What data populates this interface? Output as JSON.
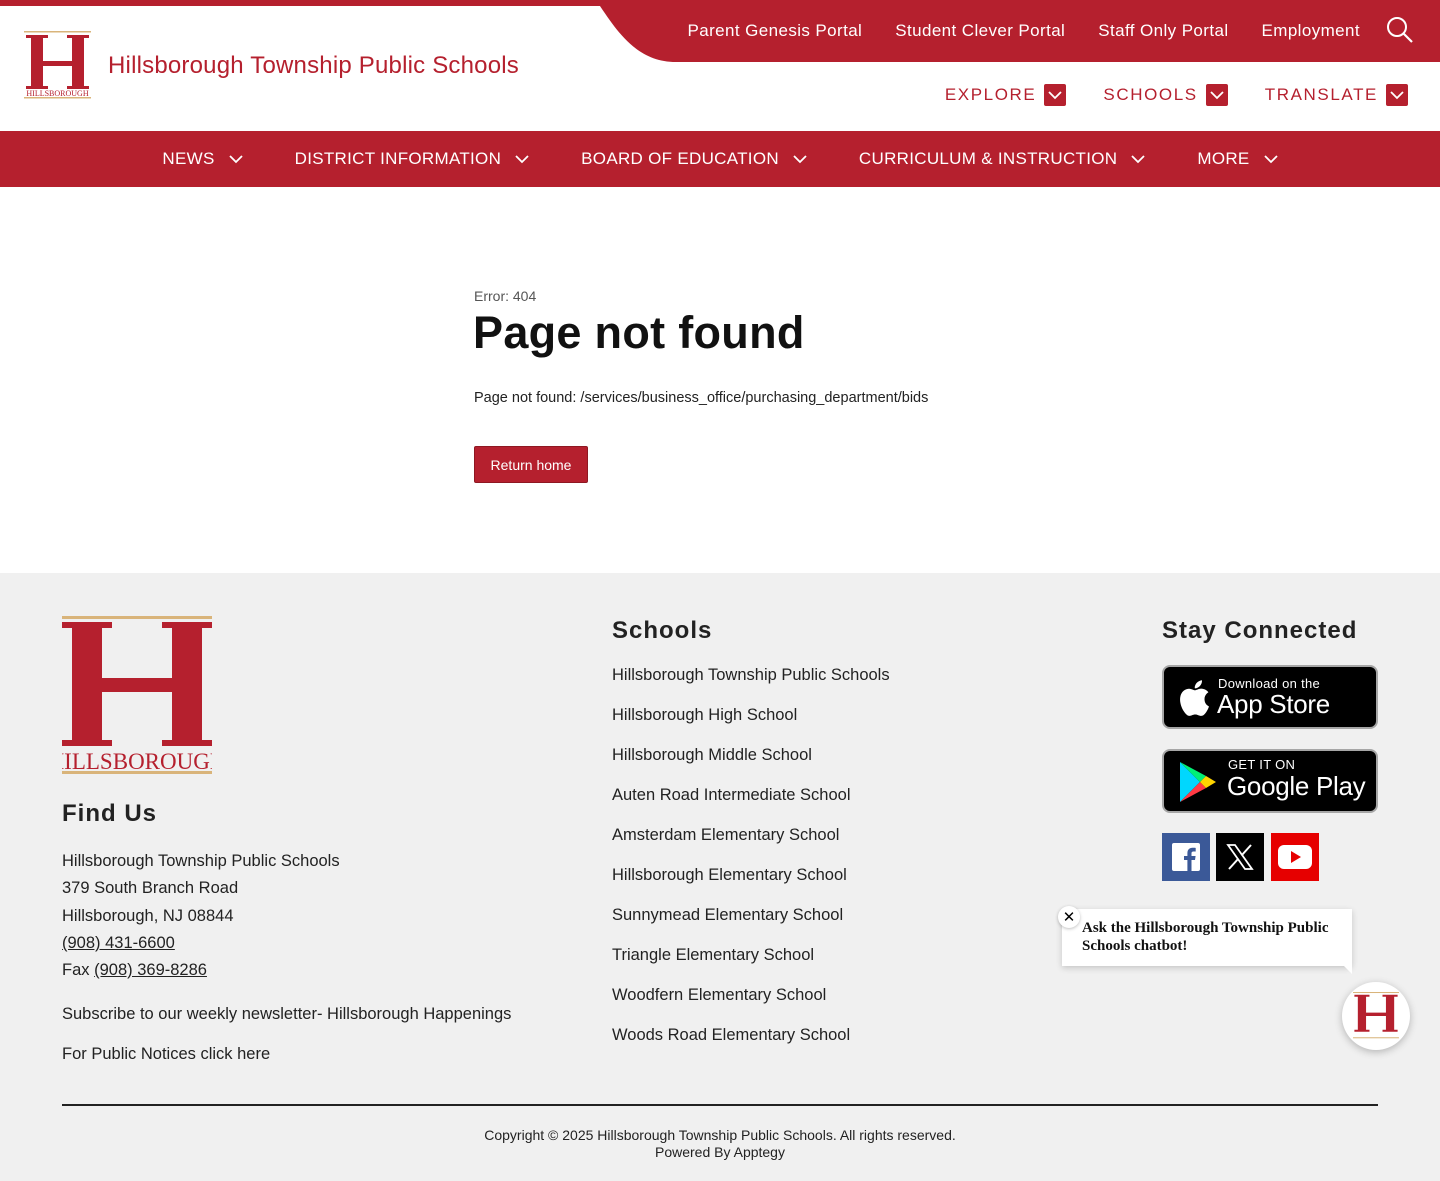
{
  "header": {
    "site_title": "Hillsborough Township Public Schools",
    "logo_caption": "HILLSBOROUGH",
    "top_links": [
      "Parent Genesis Portal",
      "Student Clever Portal",
      "Staff Only Portal",
      "Employment"
    ],
    "util_nav": [
      "EXPLORE",
      "SCHOOLS",
      "TRANSLATE"
    ]
  },
  "main_nav": [
    "NEWS",
    "DISTRICT INFORMATION",
    "BOARD OF EDUCATION",
    "CURRICULUM & INSTRUCTION",
    "MORE"
  ],
  "content": {
    "error_code": "Error: 404",
    "title": "Page not found",
    "message": "Page not found: /services/business_office/purchasing_department/bids",
    "button": "Return home"
  },
  "footer": {
    "logo_caption": "HILLSBOROUGH",
    "find_us_heading": "Find Us",
    "address": {
      "name": "Hillsborough Township Public Schools",
      "street": "379 South Branch Road",
      "city": "Hillsborough, NJ 08844",
      "phone": "(908) 431-6600",
      "fax_label": "Fax",
      "fax": "(908) 369-8286"
    },
    "newsletter": "Subscribe to our weekly newsletter- Hillsborough Happenings",
    "public_notices": "For Public Notices click here",
    "schools_heading": "Schools",
    "schools": [
      "Hillsborough Township Public Schools",
      "Hillsborough High School",
      "Hillsborough Middle School",
      "Auten Road Intermediate School",
      "Amsterdam Elementary School",
      "Hillsborough Elementary School",
      "Sunnymead Elementary School",
      "Triangle Elementary School",
      "Woodfern Elementary School",
      "Woods Road Elementary School"
    ],
    "stay_connected_heading": "Stay Connected",
    "app_store": {
      "small": "Download on the",
      "big": "App Store"
    },
    "google_play": {
      "small": "GET IT ON",
      "big": "Google Play"
    },
    "copyright": "Copyright © 2025 Hillsborough Township Public Schools. All rights reserved.",
    "powered_by": "Powered By Apptegy"
  },
  "chat": {
    "close": "✕",
    "message": "Ask the Hillsborough Township Public Schools chatbot!"
  },
  "colors": {
    "brand_red": "#b5202e",
    "facebook": "#3b5998",
    "x": "#000000",
    "youtube": "#e60000",
    "gold": "#d9b47a"
  }
}
